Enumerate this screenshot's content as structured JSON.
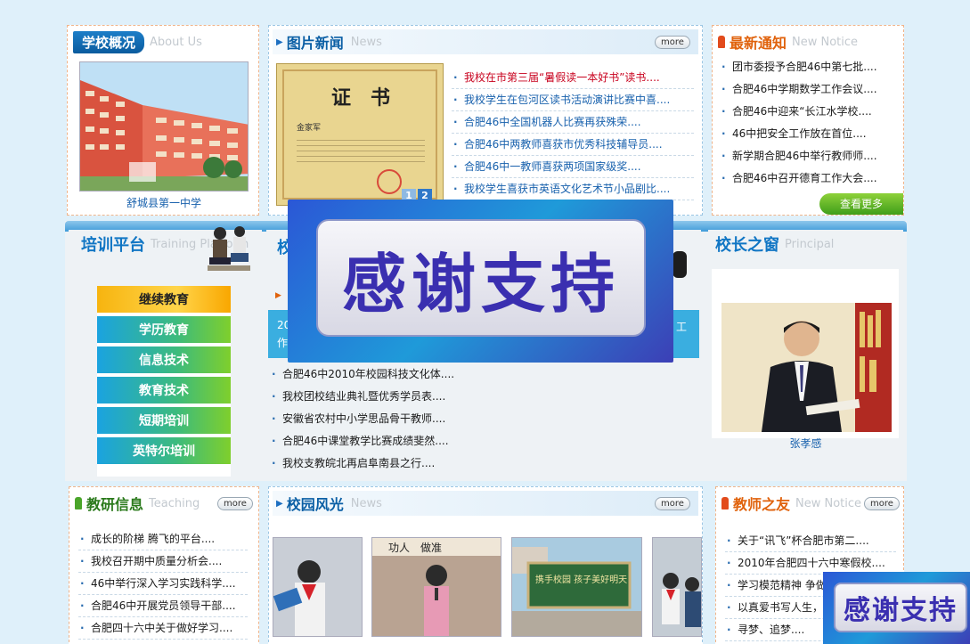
{
  "about": {
    "title": "学校概况",
    "subtitle": "About Us",
    "caption": "舒城县第一中学"
  },
  "news": {
    "title": "图片新闻",
    "subtitle": "News",
    "more": "more",
    "certificate_title": "证　书",
    "certificate_name": "金家军",
    "pages": [
      "1",
      "2"
    ],
    "items": [
      "我校在市第三届“暑假读一本好书”读书....",
      "我校学生在包河区读书活动演讲比赛中喜....",
      "合肥46中全国机器人比赛再获殊荣....",
      "合肥46中两教师喜获市优秀科技辅导员....",
      "合肥46中一教师喜获两项国家级奖....",
      "我校学生喜获市英语文化艺术节小品剧比...."
    ]
  },
  "notice": {
    "title": "最新通知",
    "subtitle": "New Notice",
    "see_more": "查看更多",
    "items": [
      "团市委授予合肥46中第七批....",
      "合肥46中学期数学工作会议....",
      "合肥46中迎来“长江水学校....",
      "46中把安全工作放在首位....",
      "新学期合肥46中举行教师师....",
      "合肥46中召开德育工作大会...."
    ]
  },
  "training": {
    "title": "培训平台",
    "subtitle": "Training Platform",
    "buttons": [
      "继续教育",
      "学历教育",
      "信息技术",
      "教育技术",
      "短期培训",
      "英特尔培训"
    ]
  },
  "campus_news": {
    "title_char": "校",
    "banner_left": "20",
    "banner_left2": "作",
    "banner_right": "工",
    "items": [
      "合肥46中2010年校园科技文化体....",
      "我校团校结业典礼暨优秀学员表....",
      "安徽省农村中小学思品骨干教师....",
      "合肥46中课堂教学比赛成绩斐然....",
      "我校支教皖北再启阜南县之行...."
    ]
  },
  "principal": {
    "title": "校长之窗",
    "subtitle": "Principal",
    "name": "张孝感"
  },
  "teaching": {
    "title": "教研信息",
    "subtitle": "Teaching",
    "more": "more",
    "items": [
      "成长的阶梯 腾飞的平台....",
      "我校召开期中质量分析会....",
      "46中举行深入学习实践科学....",
      "合肥46中开展党员领导干部....",
      "合肥四十六中关于做好学习...."
    ]
  },
  "campus_style": {
    "title": "校园风光",
    "subtitle": "News",
    "more": "more",
    "photo_sign": "功人　做准",
    "photo_board": "携手校园 孩子美好明天"
  },
  "friends": {
    "title": "教师之友",
    "subtitle": "New Notice",
    "more": "more",
    "items": [
      "关于“讯飞”杯合肥市第二....",
      "2010年合肥四十六中寒假校....",
      "学习模范精神 争做....",
      "以真爱书写人生，....",
      "寻梦、追梦...."
    ]
  },
  "overlay": {
    "text_large": "感谢支持",
    "text_small": "感谢支持"
  },
  "colors": {
    "title_blue": "#0b5fa5",
    "title_orange": "#e0620c",
    "link_red": "#c8001d",
    "link_blue": "#1861ad"
  }
}
